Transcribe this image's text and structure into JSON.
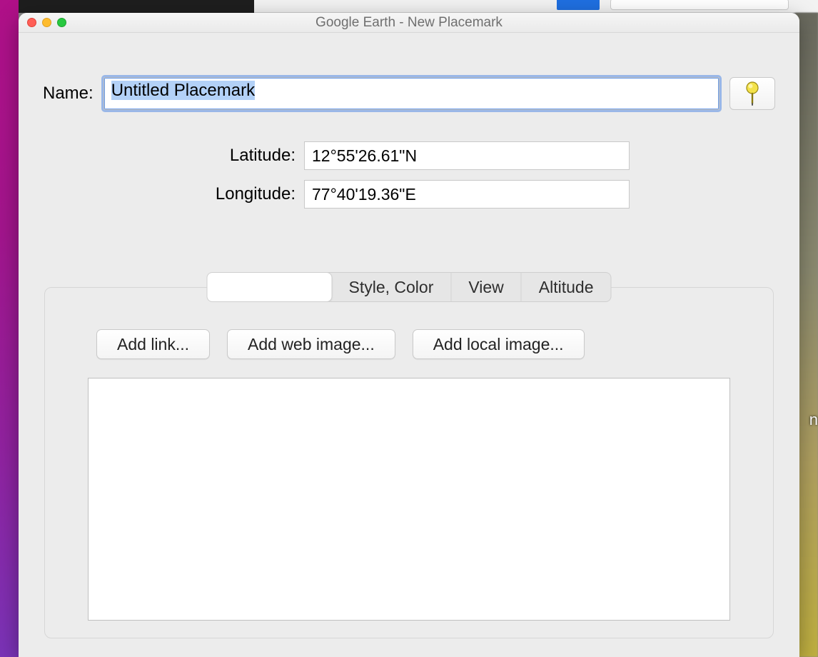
{
  "window": {
    "title": "Google Earth - New Placemark"
  },
  "form": {
    "name_label": "Name:",
    "name_value": "Untitled Placemark",
    "latitude_label": "Latitude:",
    "latitude_value": "12°55'26.61\"N",
    "longitude_label": "Longitude:",
    "longitude_value": "77°40'19.36\"E"
  },
  "tabs": {
    "description": "",
    "style_color": "Style, Color",
    "view": "View",
    "altitude": "Altitude"
  },
  "buttons": {
    "add_link": "Add link...",
    "add_web_image": "Add web image...",
    "add_local_image": "Add local image..."
  },
  "icons": {
    "pushpin": "pushpin-icon"
  }
}
